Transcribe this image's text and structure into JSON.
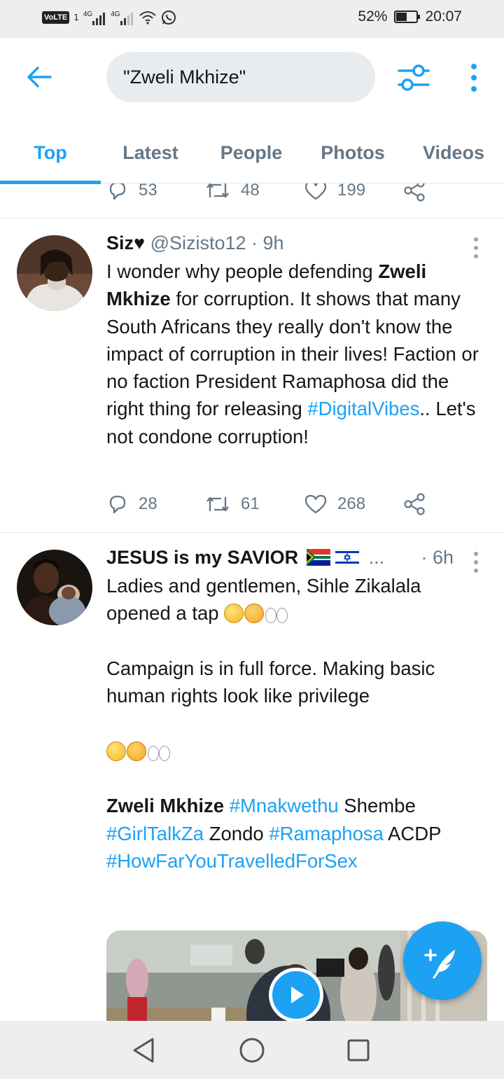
{
  "status_bar": {
    "volte": "VoLTE",
    "sim1": "1",
    "net1": "4G",
    "net2": "4G",
    "battery": "52%",
    "battery_level": 0.52,
    "time": "20:07"
  },
  "header": {
    "search_query": "\"Zweli Mkhize\""
  },
  "tabs": [
    {
      "label": "Top",
      "active": true
    },
    {
      "label": "Latest",
      "active": false
    },
    {
      "label": "People",
      "active": false
    },
    {
      "label": "Photos",
      "active": false
    },
    {
      "label": "Videos",
      "active": false
    }
  ],
  "prev_tweet": {
    "replies": "53",
    "retweets": "48",
    "likes": "199"
  },
  "tweet1": {
    "name": "Siz♥",
    "handle": "@Sizisto12",
    "sep": " · ",
    "time": "9h",
    "text_1": "I wonder why people defending ",
    "highlight_1": "Zweli Mkhize",
    "text_2": " for corruption. It shows that many South Africans they really don't know the impact of corruption in their lives! Faction or no faction President Ramaphosa did the right thing for releasing ",
    "hashtag_1": "#DigitalVibes",
    "text_3": ".. Let's not condone corruption!",
    "replies": "28",
    "retweets": "61",
    "likes": "268"
  },
  "tweet2": {
    "name": "JESUS is my SAVIOR",
    "ellipsis": "...",
    "time": "· 6h",
    "line_1": "Ladies and gentlemen, Sihle Zikalala",
    "line_2": "opened a tap",
    "line_3": "Campaign is in full force. Making basic human rights look like privilege",
    "highlight": "Zweli Mkhize",
    "tag_1": "#Mnakwethu",
    "word_1": " Shembe",
    "tag_2": "#GirlTalkZa",
    "word_2": " Zondo ",
    "tag_3": "#Ramaphosa",
    "word_3": " ACDP",
    "tag_4": "#HowFarYouTravelledForSex"
  },
  "colors": {
    "accent": "#1da1f2",
    "secondary_text": "#657786",
    "divider": "#e1e8ed"
  },
  "icons": [
    "back-arrow-icon",
    "filter-icon",
    "more-vertical-icon",
    "reply-icon",
    "retweet-icon",
    "like-icon",
    "share-icon",
    "play-icon",
    "compose-icon",
    "nav-back-icon",
    "nav-home-icon",
    "nav-recents-icon"
  ]
}
